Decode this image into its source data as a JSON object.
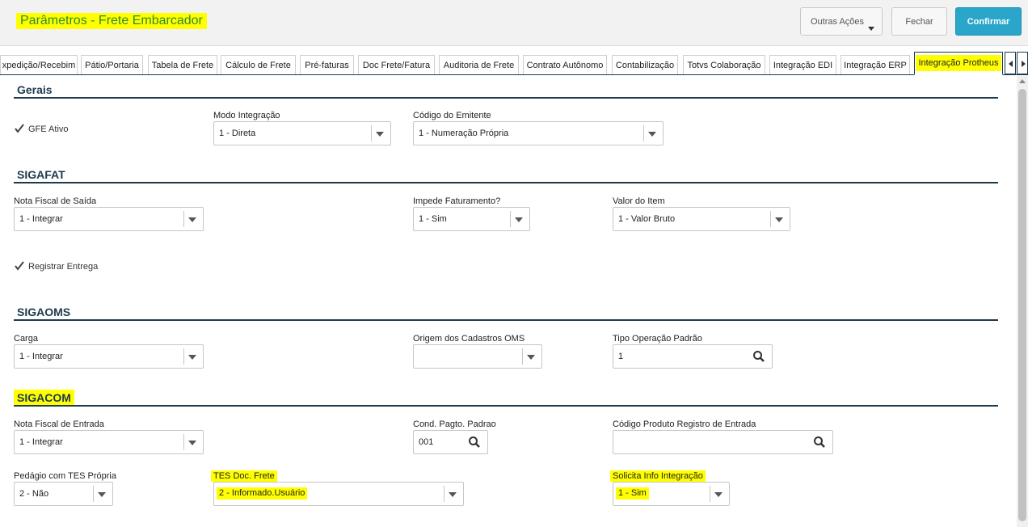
{
  "header": {
    "title": "Parâmetros - Frete Embarcador",
    "more_actions_label": "Outras Ações",
    "close_label": "Fechar",
    "confirm_label": "Confirmar"
  },
  "tabs": [
    {
      "label": "xpedição/Recebim"
    },
    {
      "label": "Pátio/Portaria"
    },
    {
      "label": "Tabela de Frete"
    },
    {
      "label": "Cálculo de Frete"
    },
    {
      "label": "Pré-faturas"
    },
    {
      "label": "Doc Frete/Fatura"
    },
    {
      "label": "Auditoria de Frete"
    },
    {
      "label": "Contrato Autônomo"
    },
    {
      "label": "Contabilização"
    },
    {
      "label": "Totvs Colaboração"
    },
    {
      "label": "Integração EDI"
    },
    {
      "label": "Integração ERP"
    },
    {
      "label": "Integração Protheus",
      "active": true
    }
  ],
  "gerais": {
    "title": "Gerais",
    "gfe_ativo": {
      "label": "GFE Ativo",
      "checked": true
    },
    "modo_integracao": {
      "label": "Modo Integração",
      "value": "1 - Direta"
    },
    "codigo_emitente": {
      "label": "Código do Emitente",
      "value": "1 - Numeração Própria"
    }
  },
  "sigafat": {
    "title": "SIGAFAT",
    "nota_fiscal_saida": {
      "label": "Nota Fiscal de Saída",
      "value": "1 - Integrar"
    },
    "impede_faturamento": {
      "label": "Impede Faturamento?",
      "value": "1 - Sim"
    },
    "valor_item": {
      "label": "Valor do Item",
      "value": "1 - Valor Bruto"
    },
    "registrar_entrega": {
      "label": "Registrar Entrega",
      "checked": true
    }
  },
  "sigaoms": {
    "title": "SIGAOMS",
    "carga": {
      "label": "Carga",
      "value": "1 - Integrar"
    },
    "origem_cadastros": {
      "label": "Origem dos Cadastros OMS",
      "value": ""
    },
    "tipo_operacao": {
      "label": "Tipo Operação Padrão",
      "value": "1"
    }
  },
  "sigacom": {
    "title": "SIGACOM",
    "nota_fiscal_entrada": {
      "label": "Nota Fiscal de Entrada",
      "value": "1 - Integrar"
    },
    "cond_pagto": {
      "label": "Cond. Pagto. Padrao",
      "value": "001"
    },
    "codigo_produto": {
      "label": "Código Produto Registro de Entrada",
      "value": ""
    },
    "pedagio": {
      "label": "Pedágio com TES Própria",
      "value": "2 - Não"
    },
    "tes_doc_frete": {
      "label": "TES Doc. Frete",
      "value": "2 - Informado.Usuário"
    },
    "solicita_info": {
      "label": "Solicita Info Integração",
      "value": "1 - Sim"
    }
  },
  "colors": {
    "highlight": "#ffff00",
    "title_green": "#2e8c2e",
    "section_blue": "#1d3a4e",
    "confirm_blue": "#29a6c9"
  }
}
